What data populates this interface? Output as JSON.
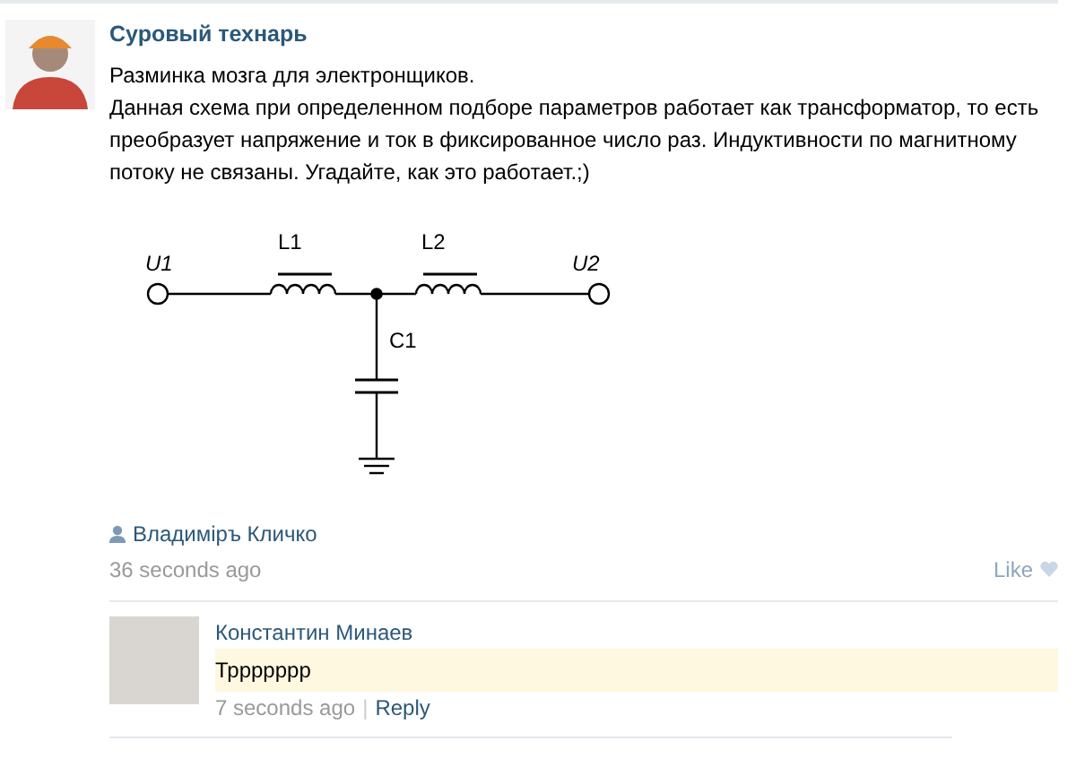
{
  "post": {
    "author": "Суровый технарь",
    "lines": [
      "Разминка мозга для электронщиков.",
      "Данная схема при определенном подборе параметров работает как трансформатор, то есть преобразует напряжение и ток в фиксированное число раз. Индуктивности по магнитному потоку не связаны. Угадайте, как это работает.;)"
    ],
    "diagram": {
      "labels": [
        "U1",
        "L1",
        "L2",
        "U2",
        "C1"
      ]
    },
    "liker": "Владимiръ Кличко",
    "time": "36 seconds ago",
    "like": "Like"
  },
  "comments": [
    {
      "author": "Константин Минаев",
      "text": "Тррррррр",
      "highlighted": true,
      "time": "7 seconds ago",
      "separator": "|",
      "reply": "Reply"
    }
  ]
}
